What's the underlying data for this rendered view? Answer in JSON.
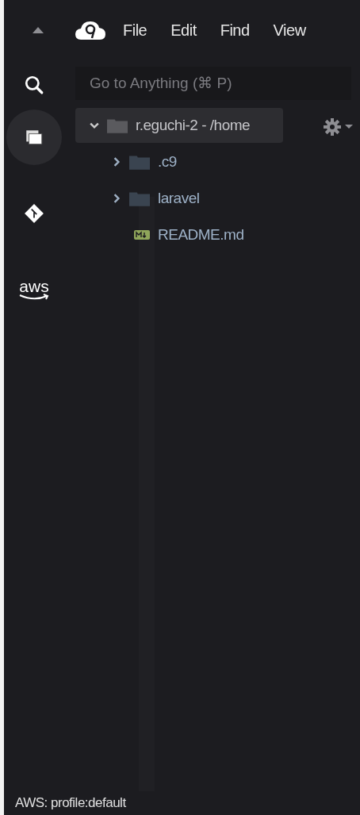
{
  "menu_bar": {
    "items": [
      "File",
      "Edit",
      "Find",
      "View"
    ]
  },
  "rail": {
    "items": [
      {
        "kind": "search",
        "selected": false
      },
      {
        "kind": "explorer",
        "selected": true
      },
      {
        "kind": "git",
        "selected": false
      },
      {
        "kind": "aws",
        "label": "aws",
        "selected": false
      }
    ]
  },
  "search": {
    "placeholder": "Go to Anything (⌘ P)"
  },
  "tree": [
    {
      "label": "r.eguchi-2 - /home",
      "expanded": true,
      "selected": true,
      "children": [
        {
          "label": ".c9",
          "kind": "folder",
          "expanded": false,
          "selected": false
        },
        {
          "label": "laravel",
          "kind": "folder",
          "expanded": false,
          "selected": false
        },
        {
          "label": "README.md",
          "kind": "markdown",
          "selected": false
        }
      ]
    }
  ],
  "status_bar": {
    "text": "AWS: profile:default"
  }
}
